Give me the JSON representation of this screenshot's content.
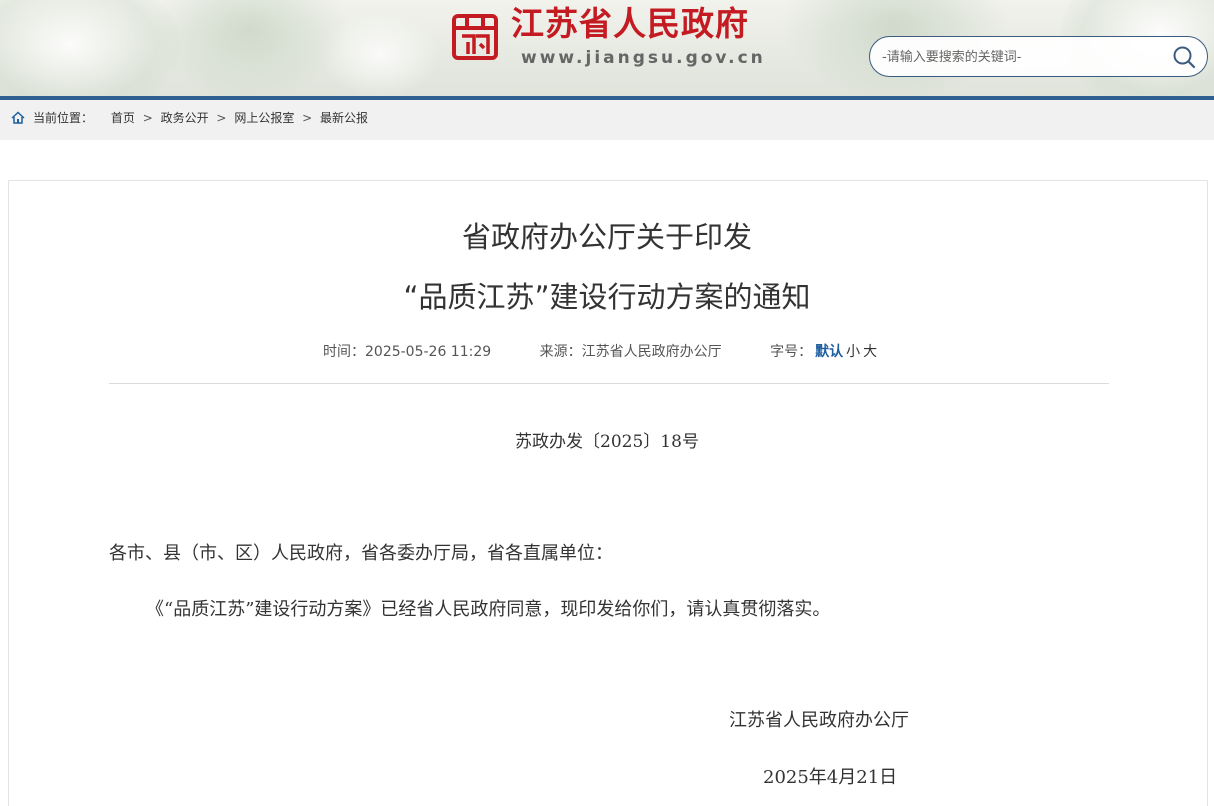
{
  "header": {
    "site_name": "江苏省人民政府",
    "site_url": "www.jiangsu.gov.cn",
    "search_placeholder": "-请输入要搜索的关键词-",
    "colors": {
      "brand_red": "#c41a21",
      "header_rule": "#2f5e91"
    }
  },
  "breadcrumb": {
    "label": "当前位置：",
    "items": [
      "首页",
      "政务公开",
      "网上公报室",
      "最新公报"
    ],
    "separator": ">"
  },
  "article": {
    "title_line1": "省政府办公厅关于印发",
    "title_line2": "“品质江苏”建设行动方案的通知",
    "meta": {
      "time_label": "时间：",
      "time_value": "2025-05-26 11:29",
      "source_label": "来源：",
      "source_value": "江苏省人民政府办公厅",
      "font_label": "字号：",
      "font_options": [
        "默认",
        "小",
        "大"
      ]
    },
    "doc_number": "苏政办发〔2025〕18号",
    "salutation": "各市、县（市、区）人民政府，省各委办厅局，省各直属单位：",
    "paragraph": "《“品质江苏”建设行动方案》已经省人民政府同意，现印发给你们，请认真贯彻落实。",
    "signature_org": "江苏省人民政府办公厅",
    "signature_date": "2025年4月21日"
  }
}
